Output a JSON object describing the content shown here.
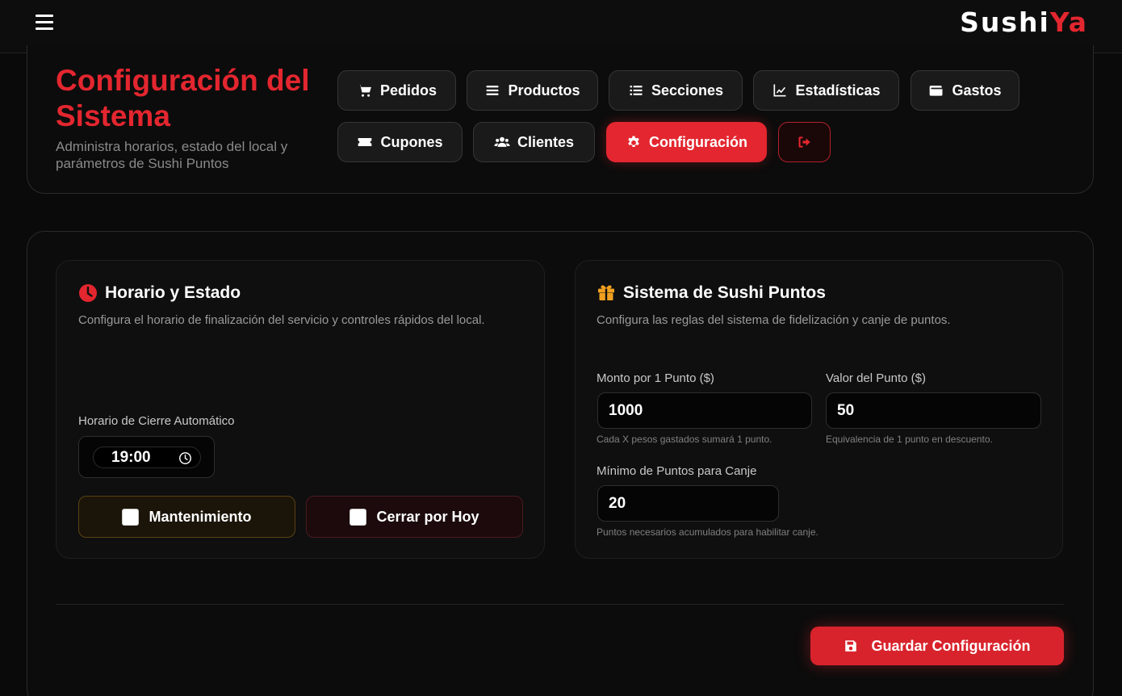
{
  "brand": {
    "part1": "Sushi",
    "part2": "Ya"
  },
  "header": {
    "title": "Configuración del Sistema",
    "subtitle": "Administra horarios, estado del local y parámetros de Sushi Puntos"
  },
  "nav": {
    "pedidos": "Pedidos",
    "productos": "Productos",
    "secciones": "Secciones",
    "estadisticas": "Estadísticas",
    "gastos": "Gastos",
    "cupones": "Cupones",
    "clientes": "Clientes",
    "configuracion": "Configuración"
  },
  "horario": {
    "title": "Horario y Estado",
    "description": "Configura el horario de finalización del servicio y controles rápidos del local.",
    "closing_label": "Horario de Cierre Automático",
    "closing_time": "19:00",
    "maintenance_label": "Mantenimiento",
    "close_today_label": "Cerrar por Hoy"
  },
  "puntos": {
    "title": "Sistema de Sushi Puntos",
    "description": "Configura las reglas del sistema de fidelización y canje de puntos.",
    "monto_label": "Monto por 1 Punto ($)",
    "monto_value": "1000",
    "monto_hint": "Cada X pesos gastados sumará 1 punto.",
    "valor_label": "Valor del Punto ($)",
    "valor_value": "50",
    "valor_hint": "Equivalencia de 1 punto en descuento.",
    "minimo_label": "Mínimo de Puntos para Canje",
    "minimo_value": "20",
    "minimo_hint": "Puntos necesarios acumulados para habilitar canje."
  },
  "actions": {
    "save_label": "Guardar Configuración"
  },
  "colors": {
    "accent": "#e3262f",
    "background": "#0a0a0a",
    "maintenance": "#5a4314",
    "gift": "#f0a020"
  }
}
